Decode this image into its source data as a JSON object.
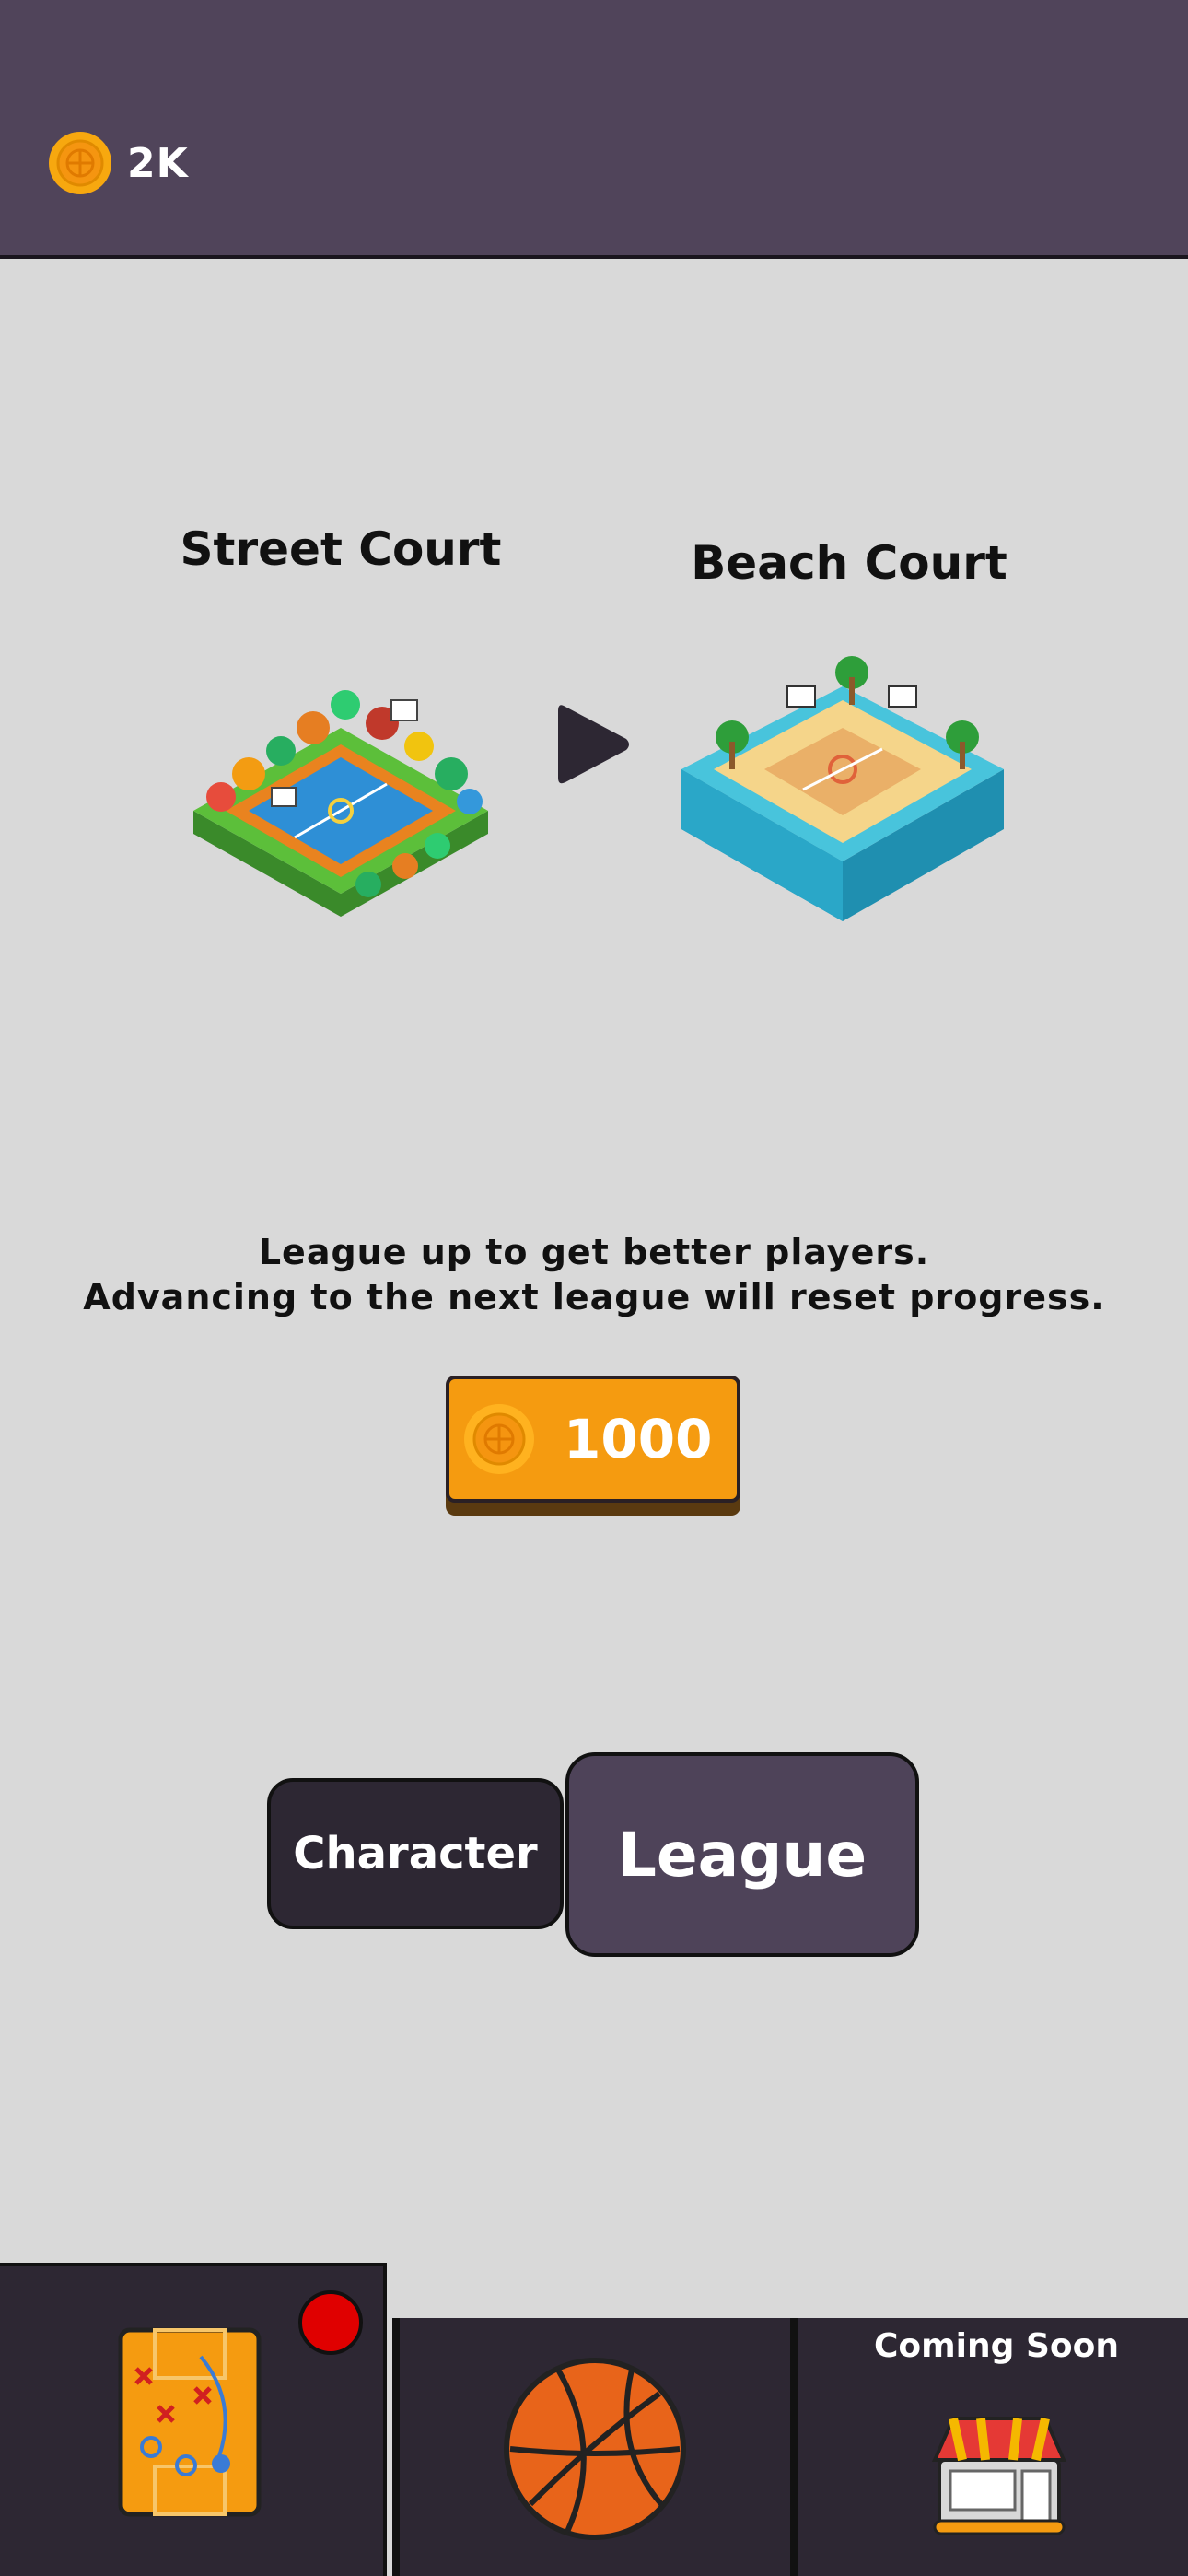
{
  "header": {
    "coins": "2K"
  },
  "courts": {
    "current": {
      "title": "Street Court"
    },
    "next": {
      "title": "Beach Court"
    }
  },
  "info": {
    "line1": "League up to get better players.",
    "line2": "Advancing to the next league will reset progress."
  },
  "upgrade": {
    "price": "1000"
  },
  "tabs": {
    "character": "Character",
    "league": "League"
  },
  "bottom_nav": {
    "shop_status": "Coming Soon"
  },
  "colors": {
    "header": "#50445a",
    "accent": "#f59b10",
    "nav": "#2d2733",
    "badge": "#e00000"
  }
}
